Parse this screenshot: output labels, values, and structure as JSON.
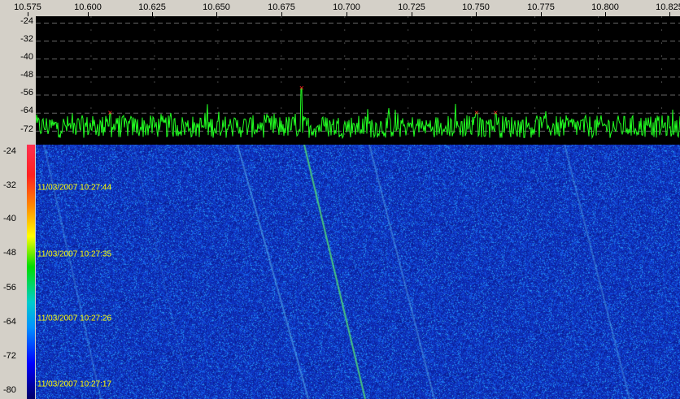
{
  "frequency_scale": {
    "labels": [
      "10.575",
      "10.600",
      "10.625",
      "10.650",
      "10.675",
      "10.700",
      "10.725",
      "10.750",
      "10.775",
      "10.800",
      "10.825"
    ]
  },
  "spectrum": {
    "amplitude_labels": [
      "-24",
      "-32",
      "-40",
      "-48",
      "-56",
      "-64",
      "-72"
    ],
    "trace_color": "#22ff22",
    "marker_color": "#ff2020",
    "peaks": [
      {
        "freq": 10.6075,
        "level": -64
      },
      {
        "freq": 10.683,
        "level": -53
      },
      {
        "freq": 10.752,
        "level": -64
      },
      {
        "freq": 10.7595,
        "level": -64
      }
    ],
    "noise_floor": -70
  },
  "waterfall": {
    "color_scale_labels": [
      "-24",
      "-32",
      "-40",
      "-48",
      "-56",
      "-64",
      "-72",
      "-80"
    ],
    "timestamps": [
      "11/03/2007 10:27:44",
      "11/03/2007 10:27:35",
      "11/03/2007 10:27:26",
      "11/03/2007 10:27:17"
    ],
    "timestamp_color": "#ffff00",
    "background_color": "#1030c8"
  }
}
